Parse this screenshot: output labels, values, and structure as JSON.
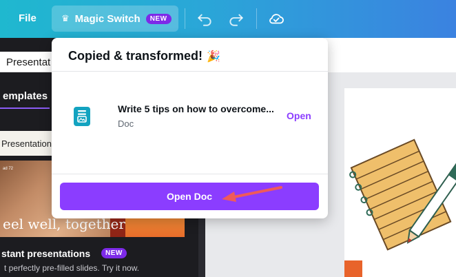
{
  "topbar": {
    "file_label": "File",
    "magic_switch_label": "Magic Switch",
    "magic_switch_badge": "NEW",
    "icons": [
      "undo-icon",
      "redo-icon",
      "cloud-saved-icon"
    ]
  },
  "sidebar": {
    "doc_title": "Presentat",
    "templates_tab": "emplates",
    "card_header": "Presentation",
    "card_image_text": "eel well, together",
    "card_image_small": "ad 72",
    "instant_title": "stant presentations",
    "instant_badge": "NEW",
    "instant_desc": "t perfectly pre-filled slides. Try it now."
  },
  "popover": {
    "title": "Copied & transformed!",
    "title_emoji": "🎉",
    "item": {
      "name": "Write 5 tips on how to overcome...",
      "type": "Doc",
      "open_label": "Open"
    },
    "primary_button": "Open Doc"
  },
  "colors": {
    "brand_purple": "#8b3dff",
    "topbar_start": "#1fb8cf",
    "topbar_end": "#3b82e0",
    "annotation_arrow": "#ef5a5a"
  }
}
